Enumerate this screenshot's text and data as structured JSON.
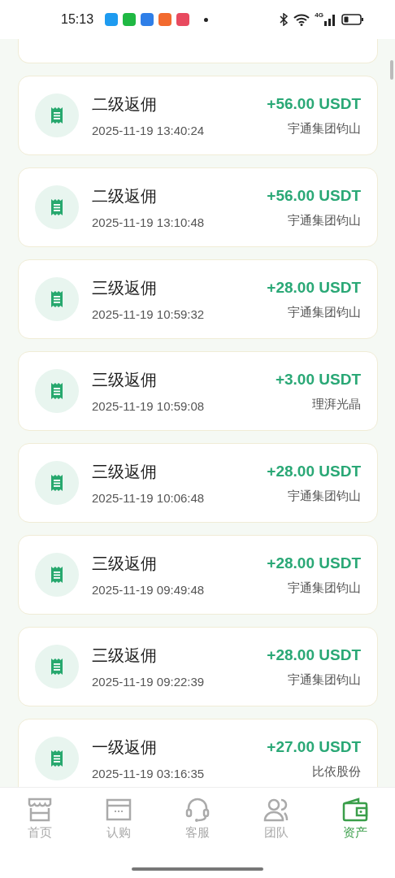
{
  "status_bar": {
    "time": "15:13",
    "network": "4G",
    "apps": [
      {
        "color": "#1e9bf0"
      },
      {
        "color": "#1fb843"
      },
      {
        "color": "#2f7fe8"
      },
      {
        "color": "#f26a2e"
      },
      {
        "color": "#e84a5f"
      }
    ]
  },
  "records": [
    {
      "title": "二级返佣",
      "time": "2025-11-19 13:40:24",
      "amount": "+56.00 USDT",
      "source": "宇通集团钧山"
    },
    {
      "title": "二级返佣",
      "time": "2025-11-19 13:10:48",
      "amount": "+56.00 USDT",
      "source": "宇通集团钧山"
    },
    {
      "title": "三级返佣",
      "time": "2025-11-19 10:59:32",
      "amount": "+28.00 USDT",
      "source": "宇通集团钧山"
    },
    {
      "title": "三级返佣",
      "time": "2025-11-19 10:59:08",
      "amount": "+3.00 USDT",
      "source": "理湃光晶"
    },
    {
      "title": "三级返佣",
      "time": "2025-11-19 10:06:48",
      "amount": "+28.00 USDT",
      "source": "宇通集团钧山"
    },
    {
      "title": "三级返佣",
      "time": "2025-11-19 09:49:48",
      "amount": "+28.00 USDT",
      "source": "宇通集团钧山"
    },
    {
      "title": "三级返佣",
      "time": "2025-11-19 09:22:39",
      "amount": "+28.00 USDT",
      "source": "宇通集团钧山"
    },
    {
      "title": "一级返佣",
      "time": "2025-11-19 03:16:35",
      "amount": "+27.00 USDT",
      "source": "比依股份"
    }
  ],
  "nav": [
    {
      "label": "首页",
      "kind": "home",
      "selected": false
    },
    {
      "label": "认购",
      "kind": "card",
      "selected": false
    },
    {
      "label": "客服",
      "kind": "support",
      "selected": false
    },
    {
      "label": "团队",
      "kind": "team",
      "selected": false
    },
    {
      "label": "资产",
      "kind": "wallet",
      "selected": true
    }
  ]
}
